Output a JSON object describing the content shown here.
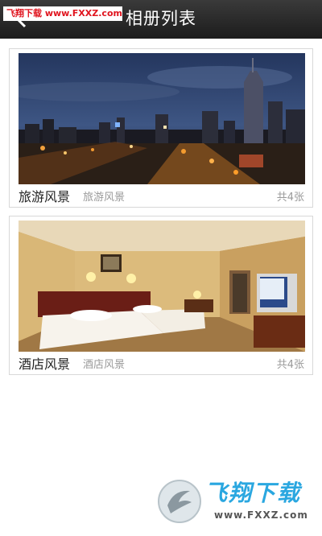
{
  "header": {
    "title": "相册列表",
    "back_icon": "back-arrow-icon",
    "watermark": "飞翔下载 www.FXXZ.com"
  },
  "albums": [
    {
      "name": "旅游风景",
      "description": "旅游风景",
      "count": "共4张",
      "image": "city-night-skyline"
    },
    {
      "name": "酒店风景",
      "description": "酒店风景",
      "count": "共4张",
      "image": "hotel-room"
    }
  ],
  "footer_watermark": {
    "brand": "飞翔下载",
    "url": "www.FXXZ.com",
    "colors": {
      "brand": "#2aa7e0"
    }
  }
}
